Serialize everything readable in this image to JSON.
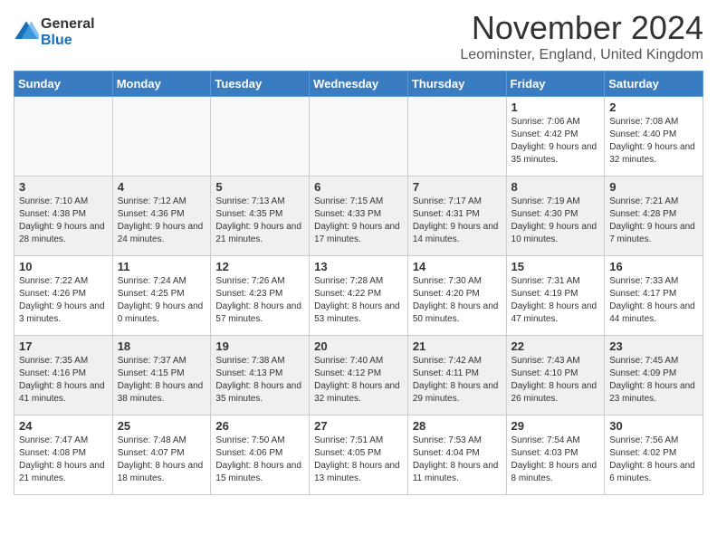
{
  "logo": {
    "general": "General",
    "blue": "Blue"
  },
  "title": "November 2024",
  "location": "Leominster, England, United Kingdom",
  "days_header": [
    "Sunday",
    "Monday",
    "Tuesday",
    "Wednesday",
    "Thursday",
    "Friday",
    "Saturday"
  ],
  "weeks": [
    [
      {
        "day": "",
        "sunrise": "",
        "sunset": "",
        "daylight": ""
      },
      {
        "day": "",
        "sunrise": "",
        "sunset": "",
        "daylight": ""
      },
      {
        "day": "",
        "sunrise": "",
        "sunset": "",
        "daylight": ""
      },
      {
        "day": "",
        "sunrise": "",
        "sunset": "",
        "daylight": ""
      },
      {
        "day": "",
        "sunrise": "",
        "sunset": "",
        "daylight": ""
      },
      {
        "day": "1",
        "sunrise": "Sunrise: 7:06 AM",
        "sunset": "Sunset: 4:42 PM",
        "daylight": "Daylight: 9 hours and 35 minutes."
      },
      {
        "day": "2",
        "sunrise": "Sunrise: 7:08 AM",
        "sunset": "Sunset: 4:40 PM",
        "daylight": "Daylight: 9 hours and 32 minutes."
      }
    ],
    [
      {
        "day": "3",
        "sunrise": "Sunrise: 7:10 AM",
        "sunset": "Sunset: 4:38 PM",
        "daylight": "Daylight: 9 hours and 28 minutes."
      },
      {
        "day": "4",
        "sunrise": "Sunrise: 7:12 AM",
        "sunset": "Sunset: 4:36 PM",
        "daylight": "Daylight: 9 hours and 24 minutes."
      },
      {
        "day": "5",
        "sunrise": "Sunrise: 7:13 AM",
        "sunset": "Sunset: 4:35 PM",
        "daylight": "Daylight: 9 hours and 21 minutes."
      },
      {
        "day": "6",
        "sunrise": "Sunrise: 7:15 AM",
        "sunset": "Sunset: 4:33 PM",
        "daylight": "Daylight: 9 hours and 17 minutes."
      },
      {
        "day": "7",
        "sunrise": "Sunrise: 7:17 AM",
        "sunset": "Sunset: 4:31 PM",
        "daylight": "Daylight: 9 hours and 14 minutes."
      },
      {
        "day": "8",
        "sunrise": "Sunrise: 7:19 AM",
        "sunset": "Sunset: 4:30 PM",
        "daylight": "Daylight: 9 hours and 10 minutes."
      },
      {
        "day": "9",
        "sunrise": "Sunrise: 7:21 AM",
        "sunset": "Sunset: 4:28 PM",
        "daylight": "Daylight: 9 hours and 7 minutes."
      }
    ],
    [
      {
        "day": "10",
        "sunrise": "Sunrise: 7:22 AM",
        "sunset": "Sunset: 4:26 PM",
        "daylight": "Daylight: 9 hours and 3 minutes."
      },
      {
        "day": "11",
        "sunrise": "Sunrise: 7:24 AM",
        "sunset": "Sunset: 4:25 PM",
        "daylight": "Daylight: 9 hours and 0 minutes."
      },
      {
        "day": "12",
        "sunrise": "Sunrise: 7:26 AM",
        "sunset": "Sunset: 4:23 PM",
        "daylight": "Daylight: 8 hours and 57 minutes."
      },
      {
        "day": "13",
        "sunrise": "Sunrise: 7:28 AM",
        "sunset": "Sunset: 4:22 PM",
        "daylight": "Daylight: 8 hours and 53 minutes."
      },
      {
        "day": "14",
        "sunrise": "Sunrise: 7:30 AM",
        "sunset": "Sunset: 4:20 PM",
        "daylight": "Daylight: 8 hours and 50 minutes."
      },
      {
        "day": "15",
        "sunrise": "Sunrise: 7:31 AM",
        "sunset": "Sunset: 4:19 PM",
        "daylight": "Daylight: 8 hours and 47 minutes."
      },
      {
        "day": "16",
        "sunrise": "Sunrise: 7:33 AM",
        "sunset": "Sunset: 4:17 PM",
        "daylight": "Daylight: 8 hours and 44 minutes."
      }
    ],
    [
      {
        "day": "17",
        "sunrise": "Sunrise: 7:35 AM",
        "sunset": "Sunset: 4:16 PM",
        "daylight": "Daylight: 8 hours and 41 minutes."
      },
      {
        "day": "18",
        "sunrise": "Sunrise: 7:37 AM",
        "sunset": "Sunset: 4:15 PM",
        "daylight": "Daylight: 8 hours and 38 minutes."
      },
      {
        "day": "19",
        "sunrise": "Sunrise: 7:38 AM",
        "sunset": "Sunset: 4:13 PM",
        "daylight": "Daylight: 8 hours and 35 minutes."
      },
      {
        "day": "20",
        "sunrise": "Sunrise: 7:40 AM",
        "sunset": "Sunset: 4:12 PM",
        "daylight": "Daylight: 8 hours and 32 minutes."
      },
      {
        "day": "21",
        "sunrise": "Sunrise: 7:42 AM",
        "sunset": "Sunset: 4:11 PM",
        "daylight": "Daylight: 8 hours and 29 minutes."
      },
      {
        "day": "22",
        "sunrise": "Sunrise: 7:43 AM",
        "sunset": "Sunset: 4:10 PM",
        "daylight": "Daylight: 8 hours and 26 minutes."
      },
      {
        "day": "23",
        "sunrise": "Sunrise: 7:45 AM",
        "sunset": "Sunset: 4:09 PM",
        "daylight": "Daylight: 8 hours and 23 minutes."
      }
    ],
    [
      {
        "day": "24",
        "sunrise": "Sunrise: 7:47 AM",
        "sunset": "Sunset: 4:08 PM",
        "daylight": "Daylight: 8 hours and 21 minutes."
      },
      {
        "day": "25",
        "sunrise": "Sunrise: 7:48 AM",
        "sunset": "Sunset: 4:07 PM",
        "daylight": "Daylight: 8 hours and 18 minutes."
      },
      {
        "day": "26",
        "sunrise": "Sunrise: 7:50 AM",
        "sunset": "Sunset: 4:06 PM",
        "daylight": "Daylight: 8 hours and 15 minutes."
      },
      {
        "day": "27",
        "sunrise": "Sunrise: 7:51 AM",
        "sunset": "Sunset: 4:05 PM",
        "daylight": "Daylight: 8 hours and 13 minutes."
      },
      {
        "day": "28",
        "sunrise": "Sunrise: 7:53 AM",
        "sunset": "Sunset: 4:04 PM",
        "daylight": "Daylight: 8 hours and 11 minutes."
      },
      {
        "day": "29",
        "sunrise": "Sunrise: 7:54 AM",
        "sunset": "Sunset: 4:03 PM",
        "daylight": "Daylight: 8 hours and 8 minutes."
      },
      {
        "day": "30",
        "sunrise": "Sunrise: 7:56 AM",
        "sunset": "Sunset: 4:02 PM",
        "daylight": "Daylight: 8 hours and 6 minutes."
      }
    ]
  ]
}
